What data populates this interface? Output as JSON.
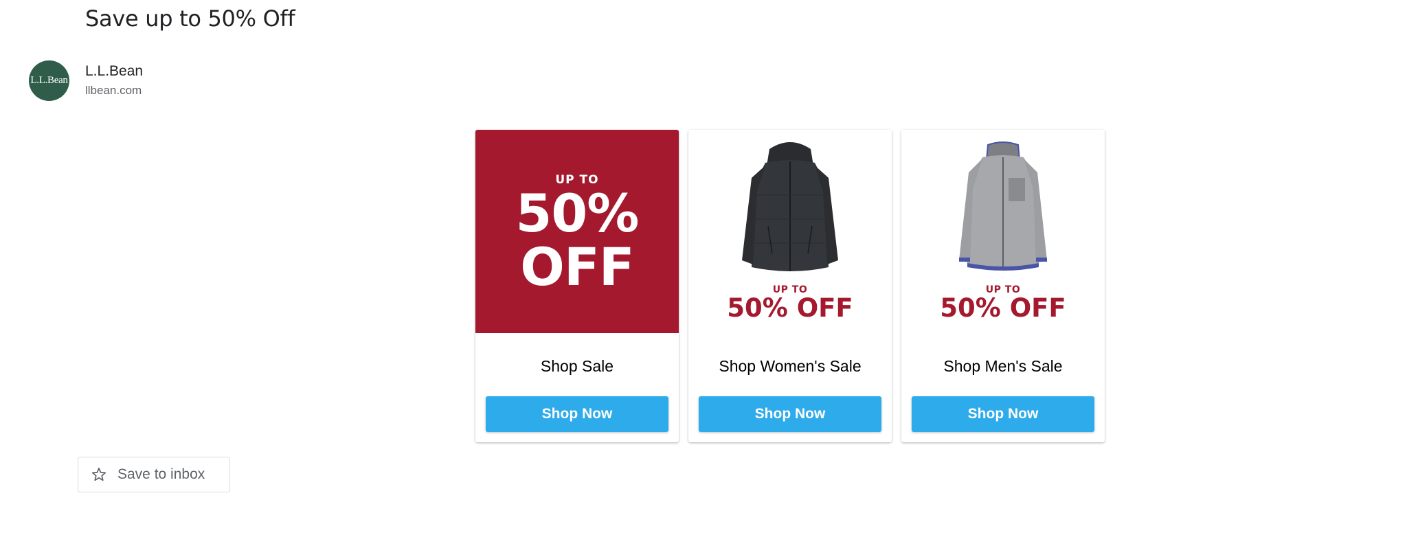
{
  "email": {
    "subject": "Save up to 50% Off",
    "sender": {
      "avatar_text": "L.L.Bean",
      "name": "L.L.Bean",
      "domain": "llbean.com"
    }
  },
  "promo": {
    "up_to": "UP TO",
    "big_line1": "50%",
    "big_line2": "OFF",
    "mini_up_to": "UP TO",
    "mini_off": "50% OFF"
  },
  "cards": [
    {
      "label": "Shop Sale",
      "button": "Shop Now",
      "image": "sale-banner"
    },
    {
      "label": "Shop Women's Sale",
      "button": "Shop Now",
      "image": "womens-jacket"
    },
    {
      "label": "Shop Men's Sale",
      "button": "Shop Now",
      "image": "mens-fleece"
    }
  ],
  "actions": {
    "save_to_inbox": "Save to inbox",
    "save_icon": "star-icon"
  },
  "colors": {
    "brand_red": "#a4192e",
    "button_blue": "#2eabea",
    "avatar_green": "#2f5d49"
  }
}
